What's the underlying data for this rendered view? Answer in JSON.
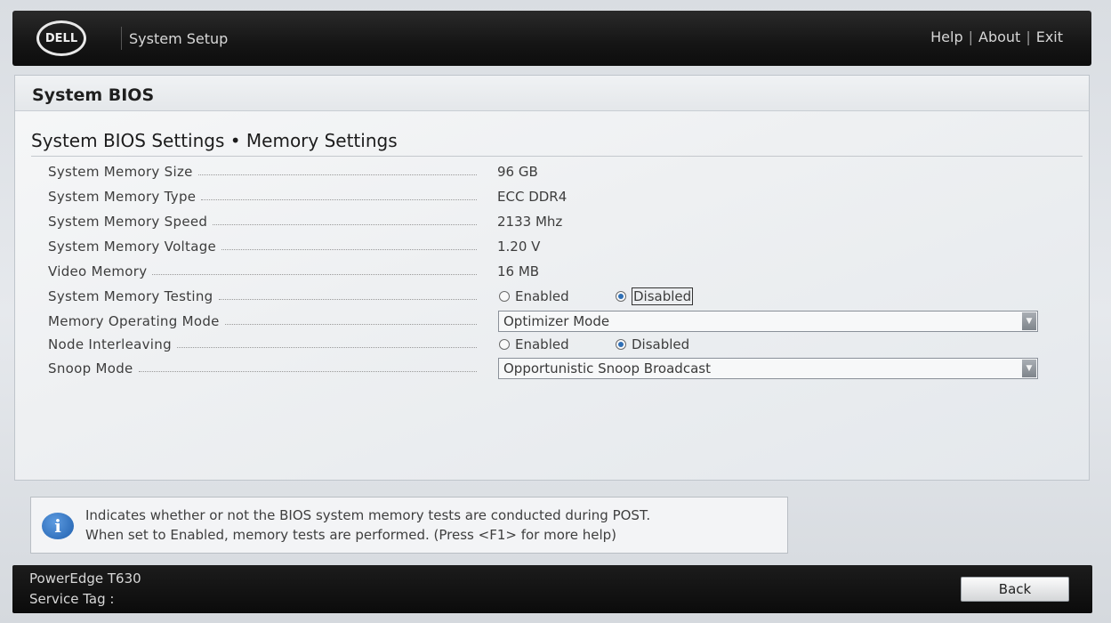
{
  "header": {
    "logo": "DELL",
    "title": "System Setup",
    "nav": [
      "Help",
      "About",
      "Exit"
    ],
    "separator": "|"
  },
  "panel": {
    "title": "System BIOS",
    "breadcrumb": "System BIOS Settings • Memory Settings"
  },
  "settings": [
    {
      "label": "System Memory Size",
      "value": "96 GB"
    },
    {
      "label": "System Memory Type",
      "value": "ECC DDR4"
    },
    {
      "label": "System Memory Speed",
      "value": "2133 Mhz"
    },
    {
      "label": "System Memory Voltage",
      "value": "1.20 V"
    },
    {
      "label": "Video Memory",
      "value": "16 MB"
    },
    {
      "label": "System Memory Testing",
      "options": [
        "Enabled",
        "Disabled"
      ],
      "selected": "Disabled"
    },
    {
      "label": "Memory Operating Mode",
      "value": "Optimizer Mode"
    },
    {
      "label": "Node Interleaving",
      "options": [
        "Enabled",
        "Disabled"
      ],
      "selected": "Disabled"
    },
    {
      "label": "Snoop Mode",
      "value": "Opportunistic Snoop Broadcast"
    }
  ],
  "help": {
    "icon": "info-icon",
    "icon_glyph": "i",
    "line1": "Indicates whether or not the BIOS system memory tests are conducted during POST.",
    "line2": "When set to Enabled, memory tests are performed. (Press <F1> for more help)"
  },
  "footer": {
    "model": "PowerEdge T630",
    "service_tag_label": "Service Tag :",
    "back_label": "Back"
  }
}
